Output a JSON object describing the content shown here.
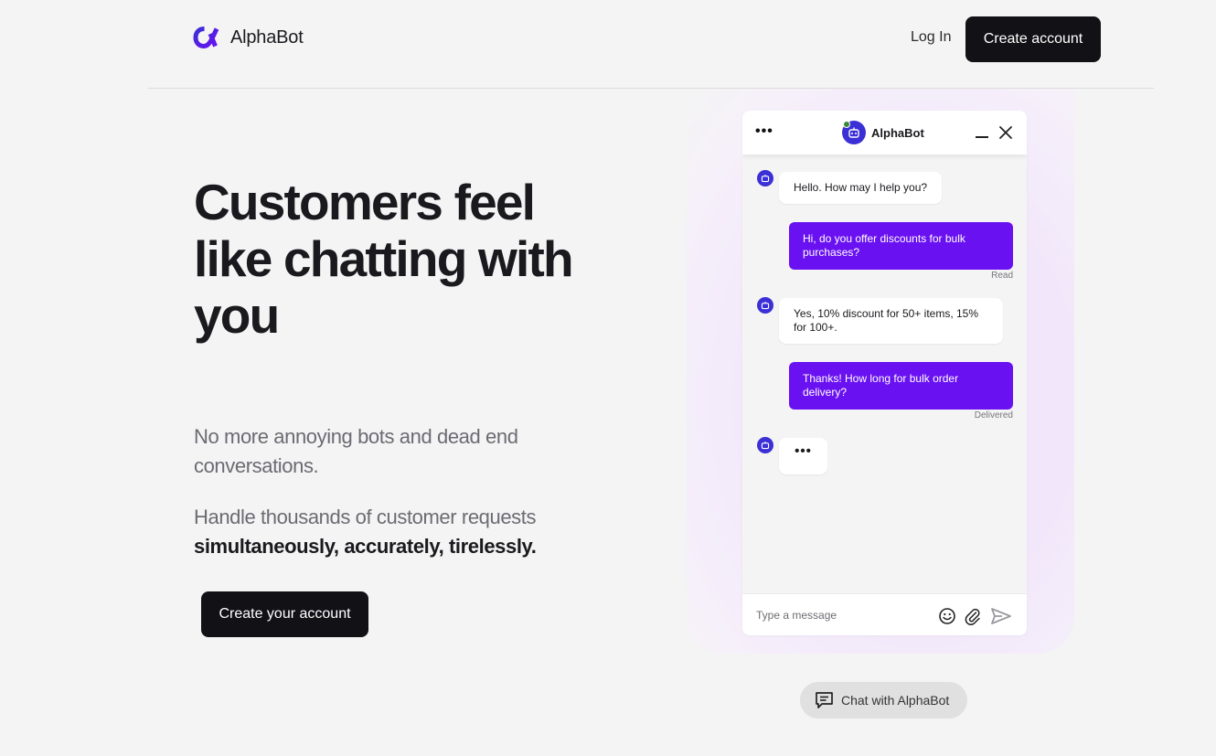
{
  "brand": {
    "name": "AlphaBot",
    "accent": "#3b2fd6",
    "accent_gradient_end": "#6a11f2"
  },
  "header": {
    "login_label": "Log In",
    "create_account_label": "Create account"
  },
  "hero": {
    "headline": "Customers feel like chatting with you",
    "sub1": "No more annoying bots and dead end conversations.",
    "sub2_plain": "Handle thousands of customer requests",
    "sub2_bold": "simultaneously, accurately, tirelessly.",
    "cta_label": "Create your account"
  },
  "chat": {
    "title": "AlphaBot",
    "messages": [
      {
        "from": "bot",
        "text": "Hello. How may I help you?"
      },
      {
        "from": "user",
        "text": "Hi, do you offer discounts for bulk purchases?",
        "status": "Read"
      },
      {
        "from": "bot",
        "text": "Yes, 10% discount for 50+ items, 15% for 100+."
      },
      {
        "from": "user",
        "text": "Thanks! How long for bulk order delivery?",
        "status": "Delivered"
      },
      {
        "from": "bot",
        "text": "•••"
      }
    ],
    "composer_placeholder": "Type a message",
    "user_bubble_color": "#6a11f2"
  },
  "launcher": {
    "label": "Chat with AlphaBot"
  },
  "icons": {
    "menu": "more-horizontal-icon",
    "minimize": "minimize-icon",
    "close": "close-icon",
    "emoji": "smiley-icon",
    "attach": "paperclip-icon",
    "send": "send-icon",
    "launcher": "chat-bubble-icon",
    "bot": "robot-icon"
  }
}
